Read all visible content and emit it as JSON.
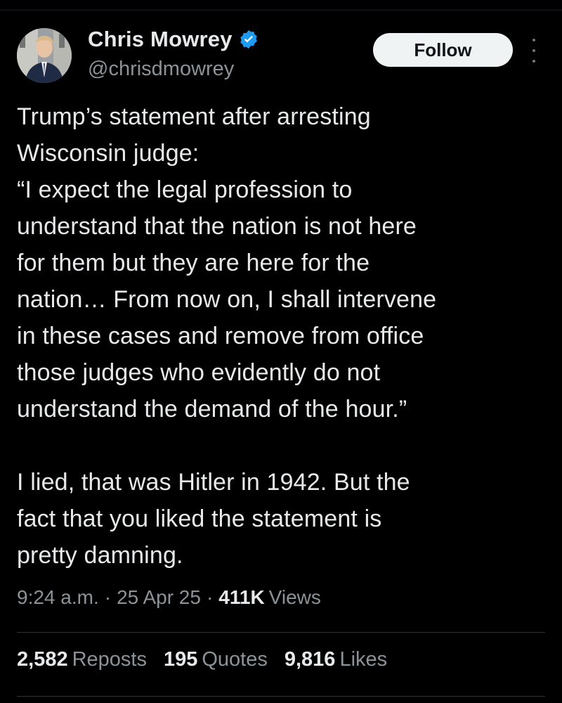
{
  "author": {
    "display_name": "Chris Mowrey",
    "handle": "@chrisdmowrey",
    "verified": true,
    "avatar": "profile-photo"
  },
  "follow_button": {
    "label": "Follow"
  },
  "more_menu": {
    "icon": "more-vertical-icon"
  },
  "tweet": {
    "paragraph1": [
      "Trump’s statement after arresting",
      "Wisconsin judge:",
      "“I expect the legal profession to",
      "understand that the nation is not here",
      "for them but they are here for the",
      "nation… From now on, I shall intervene",
      "in these cases and remove from office",
      "those judges who evidently do not",
      "understand the demand of the hour.”"
    ],
    "paragraph2": [
      "I lied, that was Hitler in 1942. But the",
      "fact that you liked the statement is",
      "pretty damning."
    ]
  },
  "meta": {
    "time": "9:24 a.m.",
    "separator": "·",
    "date": "25 Apr 25",
    "views_count": "411K",
    "views_label": "Views"
  },
  "stats": {
    "reposts": {
      "count": "2,582",
      "label": "Reposts"
    },
    "quotes": {
      "count": "195",
      "label": "Quotes"
    },
    "likes": {
      "count": "9,816",
      "label": "Likes"
    }
  },
  "colors": {
    "background": "#000000",
    "text_primary": "#e7e9ea",
    "text_secondary": "#8b9298",
    "verified_blue": "#1d9bf0",
    "follow_bg": "#eff3f4",
    "divider": "#2f3336"
  }
}
